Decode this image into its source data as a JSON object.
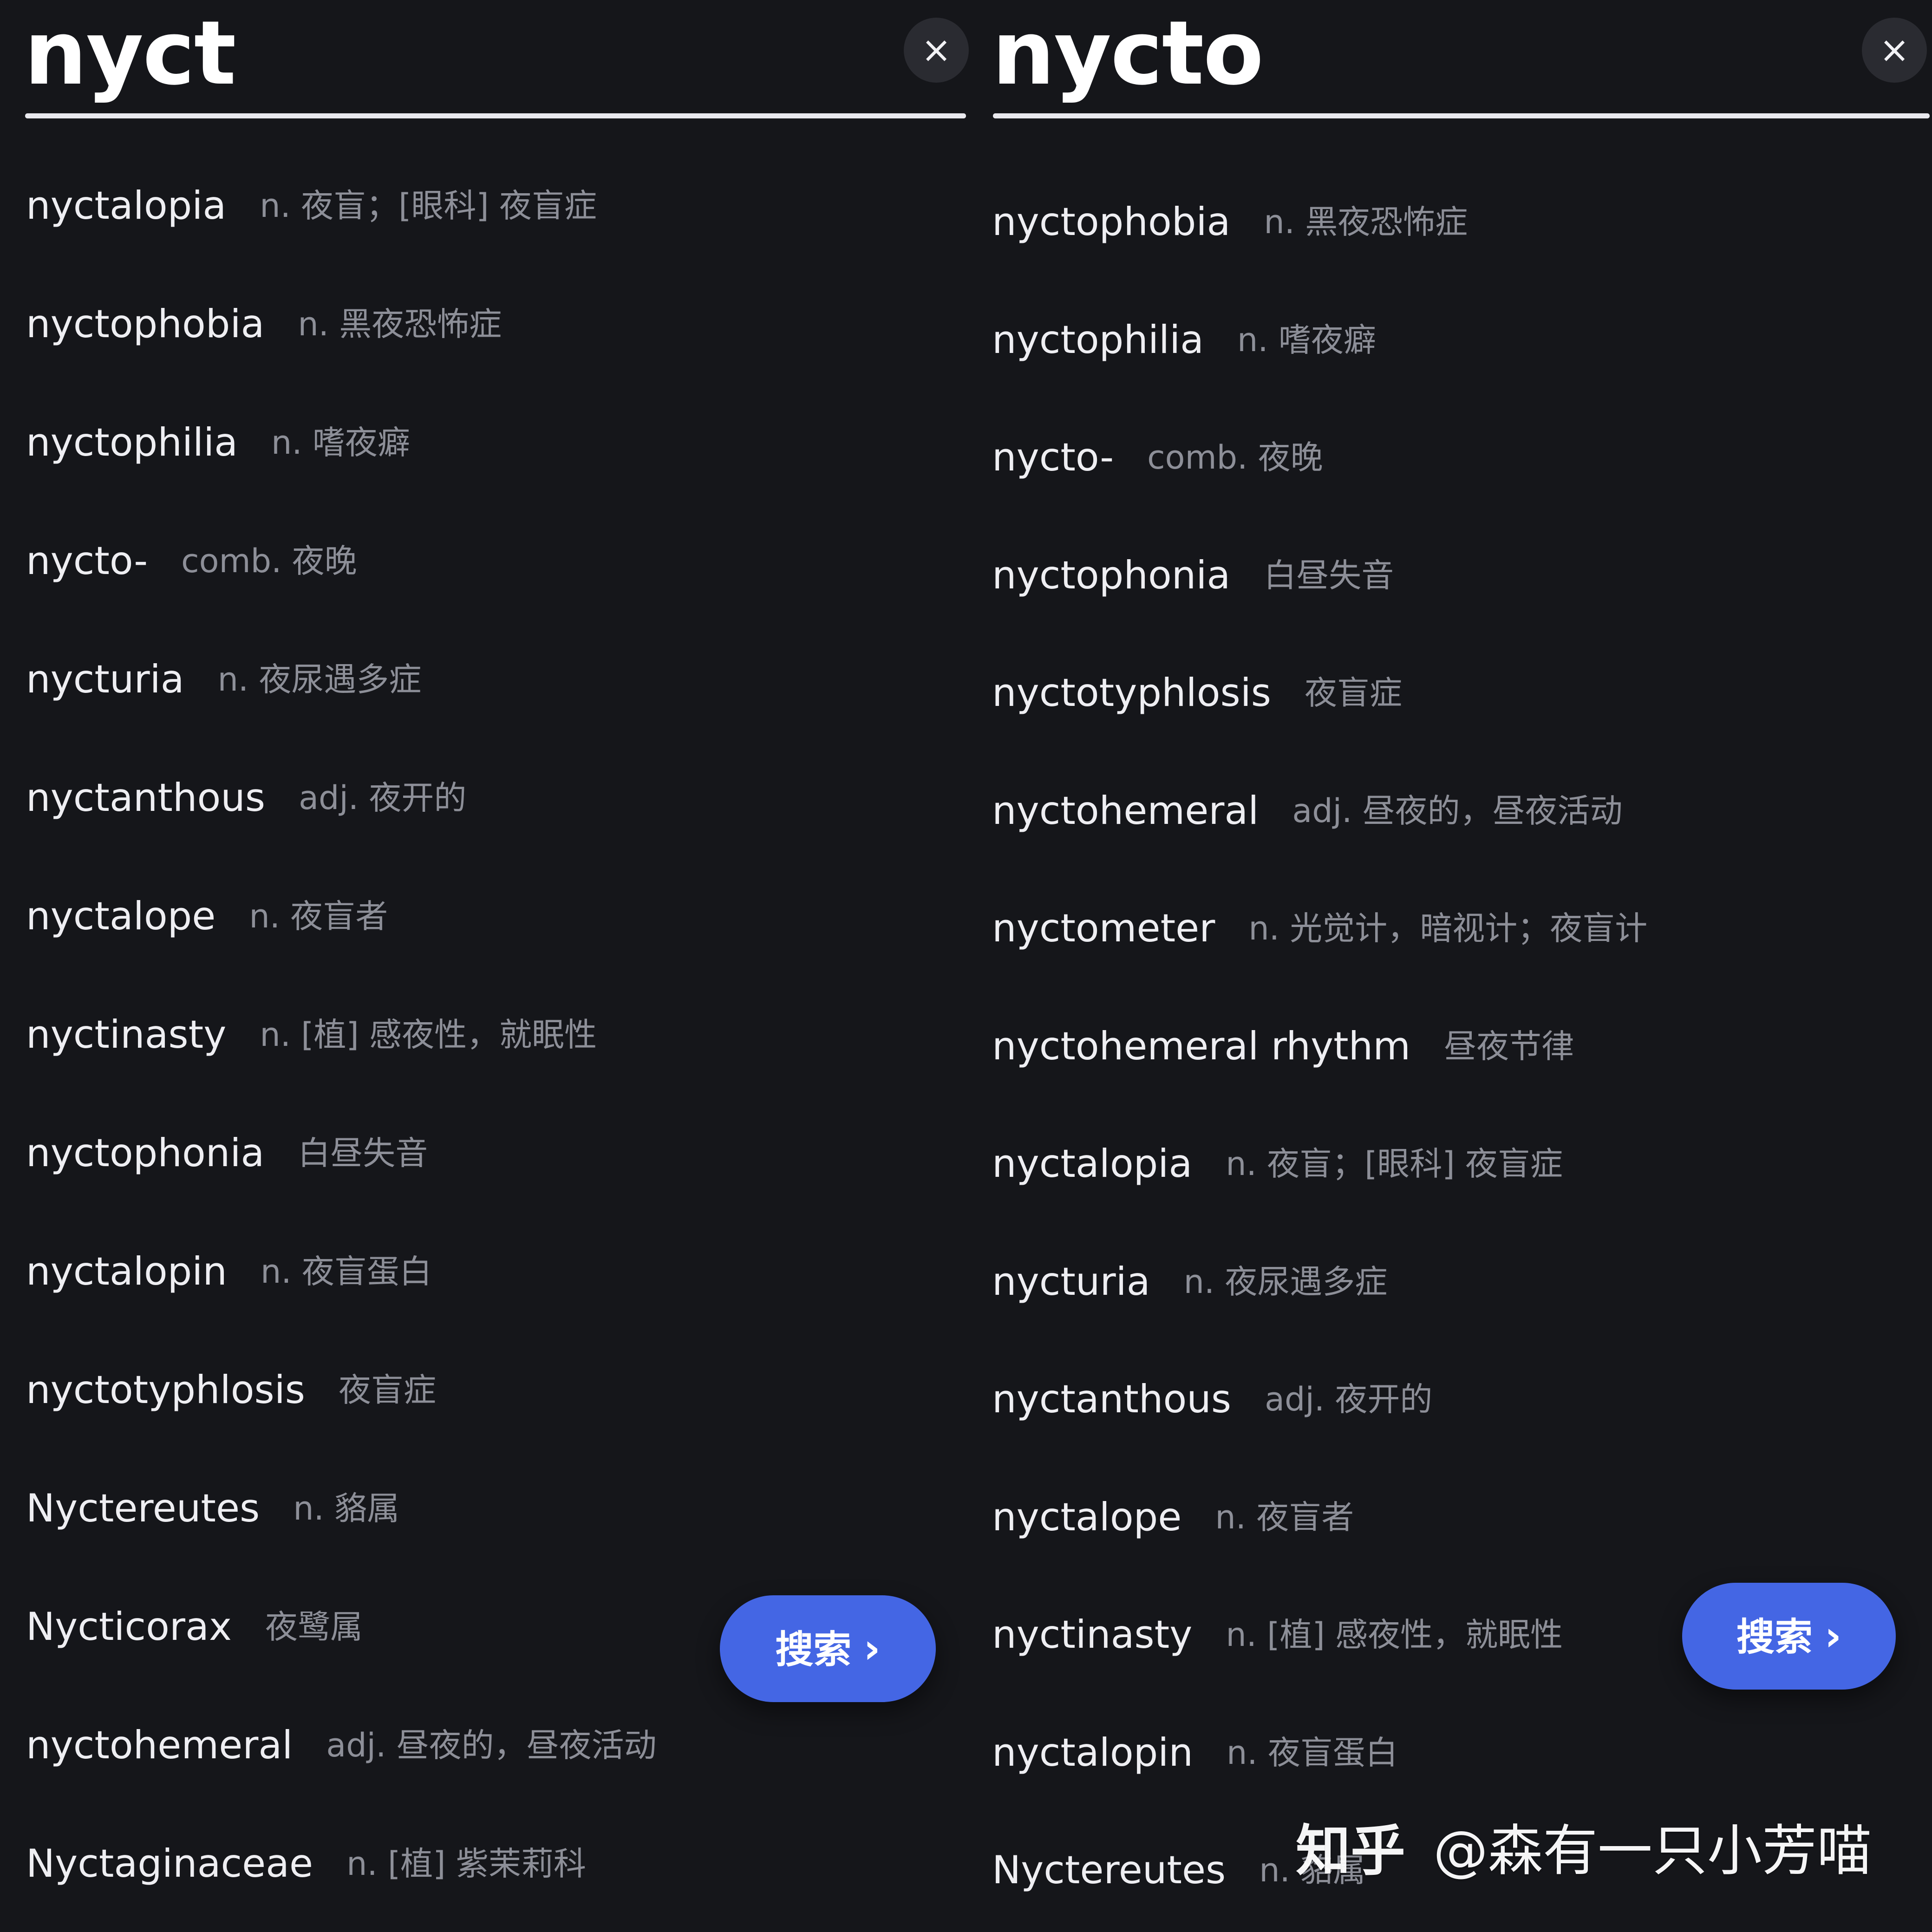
{
  "left_panel": {
    "query": "nyct",
    "clear_icon": "×",
    "search_label": "搜索",
    "chevron_icon": "›",
    "results": [
      {
        "word": "nyctalopia",
        "def": "n. 夜盲；[眼科] 夜盲症"
      },
      {
        "word": "nyctophobia",
        "def": "n. 黑夜恐怖症"
      },
      {
        "word": "nyctophilia",
        "def": "n. 嗜夜癖"
      },
      {
        "word": "nycto-",
        "def": "comb. 夜晚"
      },
      {
        "word": "nycturia",
        "def": "n. 夜尿遇多症"
      },
      {
        "word": "nyctanthous",
        "def": "adj. 夜开的"
      },
      {
        "word": "nyctalope",
        "def": "n. 夜盲者"
      },
      {
        "word": "nyctinasty",
        "def": "n. [植] 感夜性，就眠性"
      },
      {
        "word": "nyctophonia",
        "def": "白昼失音"
      },
      {
        "word": "nyctalopin",
        "def": "n. 夜盲蛋白"
      },
      {
        "word": "nyctotyphlosis",
        "def": "夜盲症"
      },
      {
        "word": "Nyctereutes",
        "def": "n. 貉属"
      },
      {
        "word": "Nycticorax",
        "def": "夜鹭属"
      },
      {
        "word": "nyctohemeral",
        "def": "adj. 昼夜的，昼夜活动"
      },
      {
        "word": "Nyctaginaceae",
        "def": "n. [植] 紫茉莉科"
      }
    ]
  },
  "right_panel": {
    "query": "nycto",
    "clear_icon": "×",
    "search_label": "搜索",
    "chevron_icon": "›",
    "results": [
      {
        "word": "nyctophobia",
        "def": "n. 黑夜恐怖症"
      },
      {
        "word": "nyctophilia",
        "def": "n. 嗜夜癖"
      },
      {
        "word": "nycto-",
        "def": "comb. 夜晚"
      },
      {
        "word": "nyctophonia",
        "def": "白昼失音"
      },
      {
        "word": "nyctotyphlosis",
        "def": "夜盲症"
      },
      {
        "word": "nyctohemeral",
        "def": "adj. 昼夜的，昼夜活动"
      },
      {
        "word": "nyctometer",
        "def": "n. 光觉计，暗视计；夜盲计"
      },
      {
        "word": "nyctohemeral rhythm",
        "def": "昼夜节律"
      },
      {
        "word": "nyctalopia",
        "def": "n. 夜盲；[眼科] 夜盲症"
      },
      {
        "word": "nycturia",
        "def": "n. 夜尿遇多症"
      },
      {
        "word": "nyctanthous",
        "def": "adj. 夜开的"
      },
      {
        "word": "nyctalope",
        "def": "n. 夜盲者"
      },
      {
        "word": "nyctinasty",
        "def": "n. [植] 感夜性，就眠性"
      },
      {
        "word": "nyctalopin",
        "def": "n. 夜盲蛋白"
      },
      {
        "word": "Nyctereutes",
        "def": "n. 貉属"
      }
    ]
  },
  "watermark": {
    "brand": "知乎",
    "user": "@森有一只小芳喵"
  }
}
